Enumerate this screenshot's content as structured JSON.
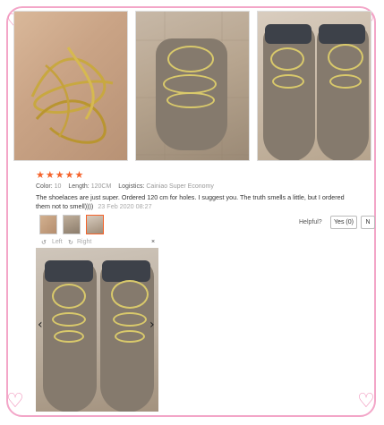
{
  "review": {
    "stars": "★★★★★",
    "color_label": "Color:",
    "color_value": "10",
    "length_label": "Length:",
    "length_value": "120CM",
    "logistics_label": "Logistics:",
    "logistics_value": "Cainiao Super Economy",
    "text": "The shoelaces are just super. Ordered 120 cm for holes. I suggest you. The truth smells a little, but I ordered them not to smell))))",
    "date": "23 Feb 2020 08:27"
  },
  "helpful": {
    "label": "Helpful?",
    "yes_label": "Yes (0)",
    "no_label": "N"
  },
  "viewer": {
    "left_label": "Left",
    "right_label": "Right",
    "close": "×",
    "prev": "‹",
    "next": "›"
  },
  "icons": {
    "rotate_left": "rotate-left-icon",
    "rotate_right": "rotate-right-icon",
    "heart": "heart-icon"
  },
  "colors": {
    "star": "#f5632b",
    "frame": "#f3a6c8",
    "heart": "#f08fb8"
  }
}
